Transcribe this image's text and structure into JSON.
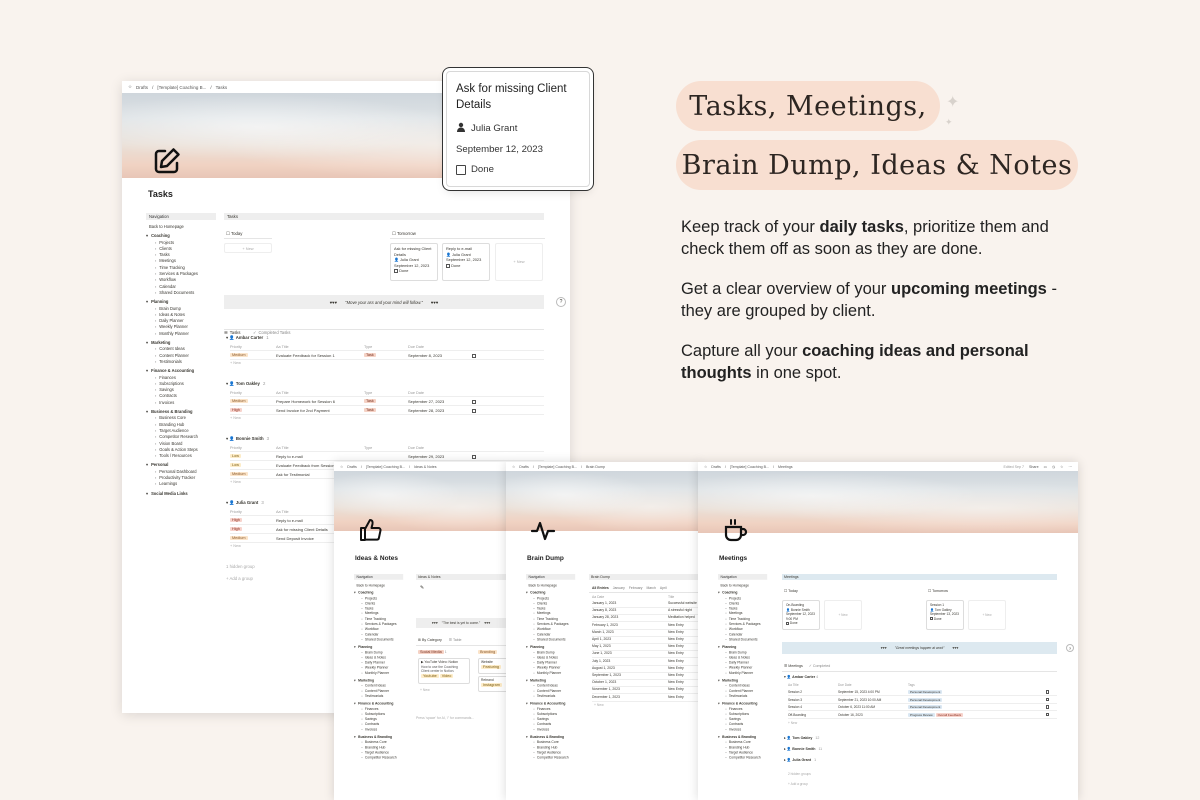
{
  "colors": {
    "background": "#f9f3ee",
    "heading_pill": "#f8dfd1",
    "medium_tag": "#fbe4c9",
    "high_tag": "#f7d3cc",
    "low_tag": "#fdecc8",
    "task_tag": "#f5d2c5"
  },
  "marketing": {
    "heading_line1": "Tasks, Meetings,",
    "heading_line2": "Brain Dump, Ideas & Notes",
    "p1_a": "Keep track of your ",
    "p1_b": "daily tasks",
    "p1_c": ", prioritize them and check them off as soon as they are done.",
    "p2_a": "Get a clear overview of your ",
    "p2_b": "upcoming meetings",
    "p2_c": " - they are grouped by client.",
    "p3_a": "Capture all your ",
    "p3_b": "coaching ideas and personal thoughts",
    "p3_c": " in one spot."
  },
  "popup": {
    "title": "Ask for missing Client Details",
    "person": "Julia Grant",
    "date": "September 12, 2023",
    "done_label": "Done",
    "icon": "person-icon"
  },
  "tasks_screen": {
    "breadcrumb": [
      "Drafts",
      "[Template] Coaching B...",
      "Tasks"
    ],
    "title": "Tasks",
    "icon": "edit-icon",
    "nav_header": "Navigation",
    "nav": [
      {
        "t": "Back to Homepage",
        "k": "back"
      },
      {
        "t": "Coaching",
        "k": "sec"
      },
      {
        "t": "Projects",
        "k": "sub"
      },
      {
        "t": "Clients",
        "k": "sub"
      },
      {
        "t": "Tasks",
        "k": "sub"
      },
      {
        "t": "Meetings",
        "k": "sub"
      },
      {
        "t": "Time Tracking",
        "k": "sub"
      },
      {
        "t": "Services & Packages",
        "k": "sub"
      },
      {
        "t": "Workflow",
        "k": "sub"
      },
      {
        "t": "Calendar",
        "k": "sub"
      },
      {
        "t": "Shared Documents",
        "k": "sub"
      },
      {
        "t": "Planning",
        "k": "sec"
      },
      {
        "t": "Brain Dump",
        "k": "sub"
      },
      {
        "t": "Ideas & Notes",
        "k": "sub"
      },
      {
        "t": "Daily Planner",
        "k": "sub"
      },
      {
        "t": "Weekly Planner",
        "k": "sub"
      },
      {
        "t": "Monthly Planner",
        "k": "sub"
      },
      {
        "t": "Marketing",
        "k": "sec"
      },
      {
        "t": "Content Ideas",
        "k": "sub"
      },
      {
        "t": "Content Planner",
        "k": "sub"
      },
      {
        "t": "Testimonials",
        "k": "sub"
      },
      {
        "t": "Finance & Accounting",
        "k": "sec"
      },
      {
        "t": "Finances",
        "k": "sub"
      },
      {
        "t": "Subscriptions",
        "k": "sub"
      },
      {
        "t": "Savings",
        "k": "sub"
      },
      {
        "t": "Contracts",
        "k": "sub"
      },
      {
        "t": "Invoices",
        "k": "sub"
      },
      {
        "t": "Business & Branding",
        "k": "sec"
      },
      {
        "t": "Business Core",
        "k": "sub"
      },
      {
        "t": "Branding Hub",
        "k": "sub"
      },
      {
        "t": "Target Audience",
        "k": "sub"
      },
      {
        "t": "Competitor Research",
        "k": "sub"
      },
      {
        "t": "Vision Board",
        "k": "sub"
      },
      {
        "t": "Goals & Action Steps",
        "k": "sub"
      },
      {
        "t": "Tools / Resources",
        "k": "sub"
      },
      {
        "t": "Personal",
        "k": "sec"
      },
      {
        "t": "Personal Dashboard",
        "k": "sub"
      },
      {
        "t": "Productivity Tracker",
        "k": "sub"
      },
      {
        "t": "Learnings",
        "k": "sub"
      },
      {
        "t": "Social Media Links",
        "k": "sec"
      }
    ],
    "tasks_header": "Tasks",
    "today_label": "Today",
    "tomorrow_label": "Tomorrow",
    "new_label": "+ New",
    "tomorrow_cards": [
      {
        "title": "Ask for missing Client Details",
        "person": "Julia Grant",
        "date": "September 12, 2023",
        "done": "Done"
      },
      {
        "title": "Reply to e-mail",
        "person": "Julia Grant",
        "date": "September 12, 2023",
        "done": "Done"
      }
    ],
    "quote": "\"Move your ass and your mind will follow.\"",
    "hearts": "♥♥♥",
    "help": "?",
    "tabs": [
      "Tasks",
      "Completed Tasks"
    ],
    "cols": [
      "Priority",
      "Aa Title",
      "Type",
      "Due Date"
    ],
    "groups": [
      {
        "name": "Ambar Carter",
        "count": "1",
        "rows": [
          {
            "p": "Medium",
            "pc": "medium",
            "t": "Evaluate Feedback for Session 1",
            "type": "Task",
            "d": "September 8, 2023"
          }
        ]
      },
      {
        "name": "Tom Oakley",
        "count": "2",
        "rows": [
          {
            "p": "Medium",
            "pc": "medium",
            "t": "Prepare Homework for Session 6",
            "type": "Task",
            "d": "September 27, 2023"
          },
          {
            "p": "High",
            "pc": "high",
            "t": "Send Invoice for 2nd Payment",
            "type": "Task",
            "d": "September 28, 2023"
          }
        ]
      },
      {
        "name": "Bonnie Smith",
        "count": "3",
        "rows": [
          {
            "p": "Low",
            "pc": "low",
            "t": "Reply to e-mail",
            "type": "",
            "d": "September 29, 2023"
          },
          {
            "p": "Low",
            "pc": "low",
            "t": "Evaluate Feedback from Session 1",
            "type": "",
            "d": ""
          },
          {
            "p": "Medium",
            "pc": "medium",
            "t": "Ask for Testimonial",
            "type": "",
            "d": ""
          }
        ]
      },
      {
        "name": "Julia Grant",
        "count": "3",
        "rows": [
          {
            "p": "High",
            "pc": "high",
            "t": "Reply to e-mail",
            "type": "",
            "d": ""
          },
          {
            "p": "High",
            "pc": "high",
            "t": "Ask for missing Client Details",
            "type": "",
            "d": ""
          },
          {
            "p": "Medium",
            "pc": "medium",
            "t": "Send Deposit Invoice",
            "type": "",
            "d": ""
          }
        ]
      }
    ],
    "new_row": "+ New",
    "hidden_group": "1 hidden group",
    "add_group": "+ Add a group"
  },
  "ideas_screen": {
    "breadcrumb": [
      "Drafts",
      "[Template] Coaching B...",
      "Ideas & Notes"
    ],
    "title": "Ideas & Notes",
    "icon": "thumbs-up-icon",
    "nav_header": "Navigation",
    "header": "Ideas & Notes",
    "quote": "\"The best is yet to come.\"",
    "hearts": "♥♥♥",
    "tabs": [
      "By Category",
      "Table"
    ],
    "cat1": "Social Media",
    "cat1_count": "1",
    "card1_title": "YouTube Video: Notion",
    "card1_desc": "How to use the Coaching Client center in Notion.",
    "card1_tags": [
      "Youtube",
      "Video"
    ],
    "cat2": "Branding",
    "card2_title": "Website",
    "card2_tag": "Featuring",
    "card3_title": "Rebrand",
    "card3_tag": "Instagram",
    "new_label": "+ New",
    "hint": "Press 'space' for AI, '/' for commands..."
  },
  "brain_screen": {
    "breadcrumb": [
      "Drafts",
      "[Template] Coaching B...",
      "Brain Dump"
    ],
    "title": "Brain Dump",
    "icon": "pulse-icon",
    "nav_header": "Navigation",
    "header": "Brain Dump",
    "tabs": [
      "All Entries",
      "January",
      "February",
      "March",
      "April"
    ],
    "cols": [
      "Aa Date",
      "Title"
    ],
    "entries": [
      {
        "d": "January 1, 2023",
        "t": "Successful website"
      },
      {
        "d": "January 8, 2023",
        "t": "A stressful night"
      },
      {
        "d": "January 28, 2023",
        "t": "Meditation helped"
      },
      {
        "d": "February 1, 2023",
        "t": "New Entry"
      },
      {
        "d": "March 1, 2023",
        "t": "New Entry"
      },
      {
        "d": "April 1, 2023",
        "t": "New Entry"
      },
      {
        "d": "May 1, 2023",
        "t": "New Entry"
      },
      {
        "d": "June 1, 2023",
        "t": "New Entry"
      },
      {
        "d": "July 1, 2023",
        "t": "New Entry"
      },
      {
        "d": "August 1, 2023",
        "t": "New Entry"
      },
      {
        "d": "September 1, 2023",
        "t": "New Entry"
      },
      {
        "d": "October 1, 2023",
        "t": "New Entry"
      },
      {
        "d": "November 1, 2023",
        "t": "New Entry"
      },
      {
        "d": "December 1, 2023",
        "t": "New Entry"
      }
    ],
    "new_label": "+ New"
  },
  "meetings_screen": {
    "breadcrumb": [
      "Drafts",
      "[Template] Coaching B...",
      "Meetings"
    ],
    "topright": [
      "Edited Sep 7",
      "Share"
    ],
    "title": "Meetings",
    "icon": "coffee-cup-icon",
    "nav_header": "Navigation",
    "header": "Meetings",
    "today_label": "Today",
    "tomorrow_label": "Tomorrow",
    "today_card": {
      "title": "On-Boarding",
      "person": "Bonnie Smith",
      "date": "September 12, 2023 9:00 PM",
      "done": "Done"
    },
    "tomorrow_card": {
      "title": "Session 1",
      "person": "Tom Oakley",
      "date": "September 13, 2023",
      "done": "Done"
    },
    "new_label": "+ New",
    "quote": "\"Great meetings happen at work\"",
    "hearts": "♥♥♥",
    "help": "?",
    "tabs": [
      "Meetings",
      "Completed"
    ],
    "cols": [
      "Aa Title",
      "Due Date",
      "Tags"
    ],
    "group1": {
      "name": "Ambar Carter",
      "count": "4"
    },
    "rows": [
      {
        "t": "Session 2",
        "d": "September 15, 2023 4:00 PM",
        "tag": "Personal Development",
        "tag2": ""
      },
      {
        "t": "Session 3",
        "d": "September 21, 2023 10:00 AM",
        "tag": "Personal Development",
        "tag2": ""
      },
      {
        "t": "Session 4",
        "d": "October 6, 2023 11:00 AM",
        "tag": "Personal Development",
        "tag2": ""
      },
      {
        "t": "Off-Boarding",
        "d": "October 16, 2023",
        "tag": "Progress Review",
        "tag2": "Overall Feedback"
      }
    ],
    "groups_more": [
      {
        "name": "Tom Oakley",
        "count": "12"
      },
      {
        "name": "Bonnie Smith",
        "count": "11"
      },
      {
        "name": "Julia Grant",
        "count": "1"
      }
    ],
    "hidden_groups": "2 hidden groups",
    "add_group": "+ Add a group"
  }
}
